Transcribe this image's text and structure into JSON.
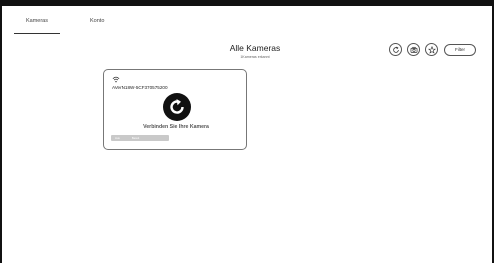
{
  "tabs": [
    {
      "label": "Kameras"
    },
    {
      "label": "Konto"
    }
  ],
  "header": {
    "title": "Alle Kameras",
    "subtitle": "1Kameras erkannt"
  },
  "toolbar": {
    "filter_label": "Filter",
    "icons": [
      "refresh-icon",
      "camera-icon",
      "star-icon"
    ]
  },
  "camera_card": {
    "name": "AVerN18W-5CF370575200",
    "message": "Verbinden Sie Ihre Kamera",
    "status_off": "Aus",
    "status_mode": "Bereit"
  },
  "colors": {
    "frame": "#111111",
    "reload_button": "#111111",
    "bar": "#c9c9c9"
  }
}
